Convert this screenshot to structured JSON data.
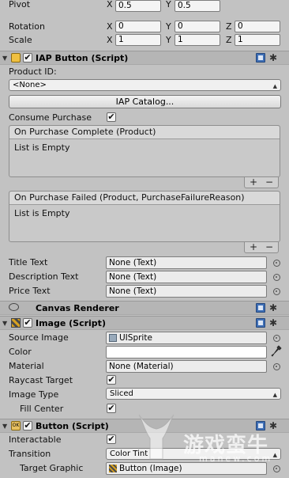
{
  "transform": {
    "pivot": {
      "label": "Pivot",
      "x": "0.5",
      "y": "0.5"
    },
    "rotation": {
      "label": "Rotation",
      "x": "0",
      "y": "0",
      "z": "0"
    },
    "scale": {
      "label": "Scale",
      "x": "1",
      "y": "1",
      "z": "1"
    },
    "axis_x": "X",
    "axis_y": "Y",
    "axis_z": "Z"
  },
  "iap": {
    "title": "IAP Button (Script)",
    "enabled": true,
    "product_id_label": "Product ID:",
    "product_id_value": "<None>",
    "catalog_button": "IAP Catalog...",
    "consume_label": "Consume Purchase",
    "consume_checked": true,
    "on_complete_title": "On Purchase Complete (Product)",
    "on_complete_body": "List is Empty",
    "on_failed_title": "On Purchase Failed (Product, PurchaseFailureReason)",
    "on_failed_body": "List is Empty",
    "plus": "+",
    "minus": "−",
    "title_text_label": "Title Text",
    "title_text_value": "None (Text)",
    "desc_text_label": "Description Text",
    "desc_text_value": "None (Text)",
    "price_text_label": "Price Text",
    "price_text_value": "None (Text)"
  },
  "canvas_renderer": {
    "title": "Canvas Renderer"
  },
  "image": {
    "title": "Image (Script)",
    "enabled": true,
    "source_label": "Source Image",
    "source_value": "UISprite",
    "color_label": "Color",
    "material_label": "Material",
    "material_value": "None (Material)",
    "raycast_label": "Raycast Target",
    "raycast_checked": true,
    "type_label": "Image Type",
    "type_value": "Sliced",
    "fill_label": "Fill Center",
    "fill_checked": true
  },
  "button": {
    "title": "Button (Script)",
    "enabled": true,
    "interactable_label": "Interactable",
    "interactable_checked": true,
    "transition_label": "Transition",
    "transition_value": "Color Tint",
    "target_label": "Target Graphic",
    "target_value": "Button (Image)"
  },
  "watermark": {
    "text": "游戏蛮牛",
    "sub": "manew.com"
  },
  "icons": {
    "check": "✔",
    "gear": "✱",
    "dropdown_arrow": "▲▼",
    "eyedropper": "eyedropper-icon"
  }
}
